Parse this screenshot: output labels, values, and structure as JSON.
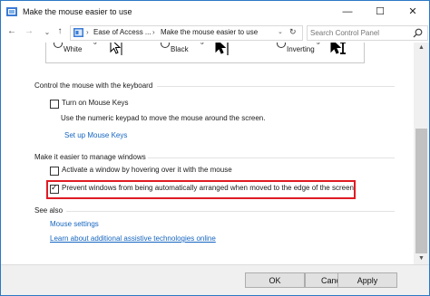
{
  "window": {
    "title": "Make the mouse easier to use",
    "min_glyph": "—",
    "max_glyph": "☐",
    "close_glyph": "✕"
  },
  "nav": {
    "back_glyph": "←",
    "forward_glyph": "→",
    "dropdown_glyph": "⌄",
    "up_glyph": "↑",
    "breadcrumb": [
      "Ease of Access ...",
      "Make the mouse easier to use"
    ],
    "separator_glyph": "›",
    "address_dropdown_glyph": "⌄",
    "refresh_glyph": "↻",
    "search_placeholder": "Search Control Panel"
  },
  "pointers": [
    {
      "label": "Extra Large White",
      "style": "white",
      "selected": false
    },
    {
      "label": "Extra Large Black",
      "style": "black",
      "selected": false
    },
    {
      "label": "Extra Large Inverting",
      "style": "inverting",
      "selected": false
    }
  ],
  "keyboard_section": {
    "title": "Control the mouse with the keyboard",
    "mouse_keys_label": "Turn on Mouse Keys",
    "mouse_keys_checked": false,
    "description": "Use the numeric keypad to move the mouse around the screen.",
    "setup_link": "Set up Mouse Keys"
  },
  "windows_section": {
    "title": "Make it easier to manage windows",
    "activate_label": "Activate a window by hovering over it with the mouse",
    "activate_checked": false,
    "prevent_label": "Prevent windows from being automatically arranged when moved to the edge of the screen",
    "prevent_checked": true,
    "highlight_color": "#e01b24"
  },
  "see_also": {
    "title": "See also",
    "links": [
      "Mouse settings",
      "Learn about additional assistive technologies online"
    ]
  },
  "footer": {
    "ok_label": "OK",
    "cancel_label": "Cancel",
    "apply_label": "Apply"
  },
  "colors": {
    "link": "#1565c0",
    "window_border": "#2b78c5"
  }
}
